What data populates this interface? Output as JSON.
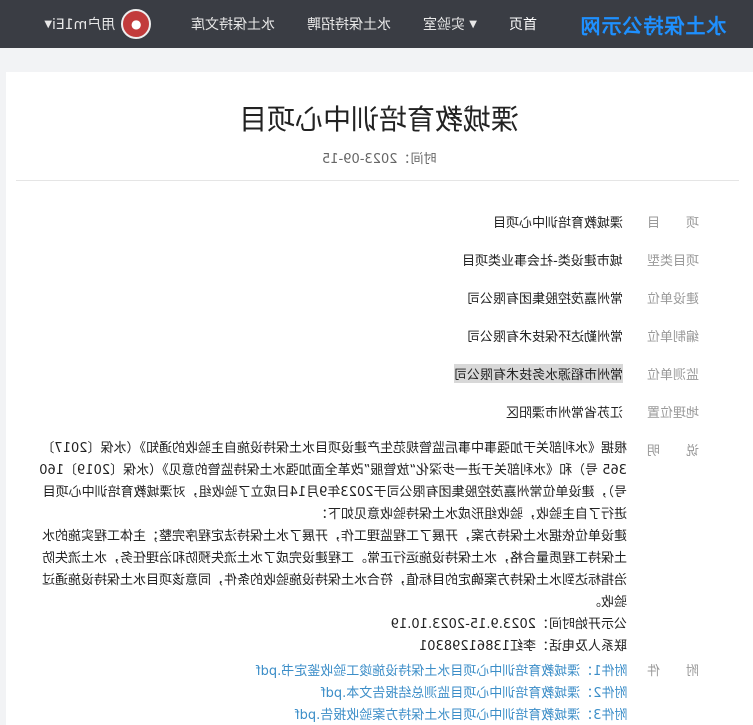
{
  "header": {
    "logo": "水土保持公示网",
    "nav": [
      {
        "label": "首页"
      },
      {
        "label": "实验室",
        "has_dropdown": true
      },
      {
        "label": "水土保持招聘"
      },
      {
        "label": "水土保持文库"
      }
    ],
    "user": {
      "name": "用户m1Ei"
    }
  },
  "article": {
    "title": "溧城教育培训中心项目",
    "time": "时间：2023-09-15"
  },
  "fields": [
    {
      "label": "项　　目",
      "value": "溧城教育培训中心项目"
    },
    {
      "label": "项目类型",
      "value": "城市建设类-社会事业类项目"
    },
    {
      "label": "建设单位",
      "value": "常州嘉茂控股集团有限公司"
    },
    {
      "label": "编制单位",
      "value": "常州勤达环保技术有限公司"
    },
    {
      "label": "监测单位",
      "value": "常州市稻源水务技术有限公司"
    },
    {
      "label": "地理位置",
      "value": "江苏省常州市溧阳区"
    }
  ],
  "description": {
    "label": "说　　明",
    "paragraphs": [
      "根据《水利部关于加强事中事后监管规范生产建设项目水土保持设施自主验收的通知》（水保〔2017〕365 号）和《水利部关于进一步深化“放管服”改革全面加强水土保持监管的意见》（水保〔2019〕160 号），建设单位常州嘉茂控股集团有限公司于2023年9月14日成立了验收组，对溧城教育培训中心项目进行了自主验收，验收组形成水土保持验收意见如下：",
      "建设单位依据水土保持方案，开展了工程监理工作，开展了水土保持法定程序完整；主体工程实施的水土保持工程质量合格，水土保持设施运行正常。工程建设完成了水土流失预防和治理任务，水土流失防治指标达到水土保持方案确定的目标值，符合水土保持设施验收的条件，同意该项目水土保持设施通过验收。",
      "公示开始时间：2023.9.15-2023.10.19",
      "联系人及电话：李红13861298301"
    ]
  },
  "attachments": {
    "label": "附　　件",
    "items": [
      "附件1：溧城教育培训中心项目水土保持设施竣工验收鉴定书.pdf",
      "附件2：溧城教育培训中心项目监测总结报告文本.pdf",
      "附件3：溧城教育培训中心项目水土保持方案验收报告.pdf"
    ]
  },
  "colors": {
    "header_bg": "#3a3d44",
    "logo": "#1e90ff",
    "link": "#3c8ec8"
  }
}
